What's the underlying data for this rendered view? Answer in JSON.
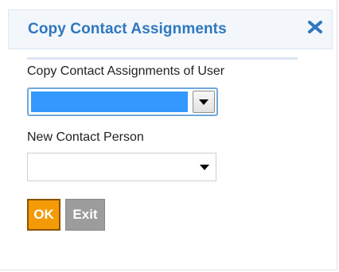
{
  "dialog": {
    "title": "Copy Contact Assignments",
    "close_icon": "close-x-icon"
  },
  "form": {
    "copy_from_label": "Copy Contact Assignments of User",
    "copy_from_value": "",
    "new_contact_label": "New Contact Person",
    "new_contact_value": ""
  },
  "actions": {
    "ok_label": "OK",
    "exit_label": "Exit"
  },
  "colors": {
    "title": "#2f77bf",
    "selected_highlight": "#3399ff",
    "ok_button": "#f59a07",
    "exit_button": "#9c9c9c"
  }
}
